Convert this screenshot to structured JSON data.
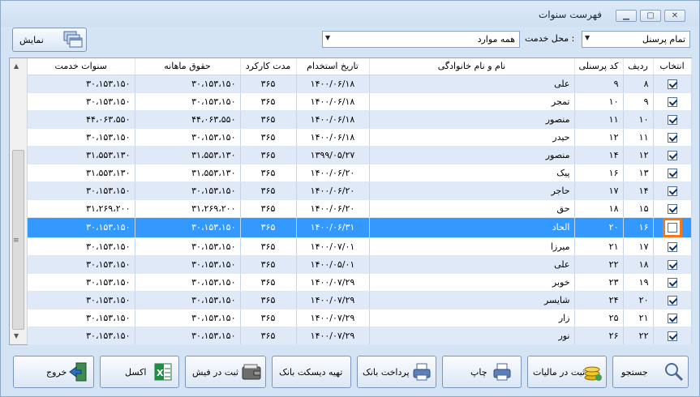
{
  "window": {
    "title": "فهرست سنوات"
  },
  "toolbar": {
    "show_label": "نمایش",
    "service_label": "محل خدمت :",
    "service_value": "همه موارد",
    "personnel_value": "تمام پرسنل"
  },
  "columns": [
    "انتخاب",
    "ردیف",
    "کد پرسنلی",
    "نام و نام خانوادگی",
    "تاریخ استخدام",
    "مدت کارکرد",
    "حقوق ماهانه",
    "سنوات خدمت"
  ],
  "rows": [
    {
      "checked": true,
      "radif": "۸",
      "code": "۹",
      "name": "علی",
      "date": "۱۴۰۰/۰۶/۱۸",
      "days": "۳۶۵",
      "salary": "۳۰،۱۵۳،۱۵۰",
      "sanavat": "۳۰،۱۵۳،۱۵۰"
    },
    {
      "checked": true,
      "radif": "۹",
      "code": "۱۰",
      "name": "تمجر",
      "date": "۱۴۰۰/۰۶/۱۸",
      "days": "۳۶۵",
      "salary": "۳۰،۱۵۳،۱۵۰",
      "sanavat": "۳۰،۱۵۳،۱۵۰"
    },
    {
      "checked": true,
      "radif": "۱۰",
      "code": "۱۱",
      "name": "منصور",
      "date": "۱۴۰۰/۰۶/۱۸",
      "days": "۳۶۵",
      "salary": "۴۴،۰۶۳،۵۵۰",
      "sanavat": "۴۴،۰۶۳،۵۵۰"
    },
    {
      "checked": true,
      "radif": "۱۱",
      "code": "۱۲",
      "name": "حیدر",
      "date": "۱۴۰۰/۰۶/۱۸",
      "days": "۳۶۵",
      "salary": "۳۰،۱۵۳،۱۵۰",
      "sanavat": "۳۰،۱۵۳،۱۵۰"
    },
    {
      "checked": true,
      "radif": "۱۲",
      "code": "۱۴",
      "name": "منصور",
      "date": "۱۳۹۹/۰۵/۲۷",
      "days": "۳۶۵",
      "salary": "۳۱،۵۵۳،۱۳۰",
      "sanavat": "۳۱،۵۵۳،۱۳۰"
    },
    {
      "checked": true,
      "radif": "۱۳",
      "code": "۱۶",
      "name": "پیک",
      "date": "۱۴۰۰/۰۶/۲۰",
      "days": "۳۶۵",
      "salary": "۳۱،۵۵۳،۱۳۰",
      "sanavat": "۳۱،۵۵۳،۱۳۰"
    },
    {
      "checked": true,
      "radif": "۱۴",
      "code": "۱۷",
      "name": "حاجر",
      "date": "۱۴۰۰/۰۶/۲۰",
      "days": "۳۶۵",
      "salary": "۳۰،۱۵۳،۱۵۰",
      "sanavat": "۳۰،۱۵۳،۱۵۰"
    },
    {
      "checked": true,
      "radif": "۱۵",
      "code": "۱۸",
      "name": "حق",
      "date": "۱۴۰۰/۰۶/۲۰",
      "days": "۳۶۵",
      "salary": "۳۱،۲۶۹،۲۰۰",
      "sanavat": "۳۱،۲۶۹،۲۰۰"
    },
    {
      "checked": false,
      "radif": "۱۶",
      "code": "۲۰",
      "name": "الحاد",
      "date": "۱۴۰۰/۰۶/۳۱",
      "days": "۳۶۵",
      "salary": "۳۰،۱۵۳،۱۵۰",
      "sanavat": "۳۰،۱۵۳،۱۵۰",
      "selected": true
    },
    {
      "checked": true,
      "radif": "۱۷",
      "code": "۲۱",
      "name": "میرزا",
      "date": "۱۴۰۰/۰۷/۰۱",
      "days": "۳۶۵",
      "salary": "۳۰،۱۵۳،۱۵۰",
      "sanavat": "۳۰،۱۵۳،۱۵۰"
    },
    {
      "checked": true,
      "radif": "۱۸",
      "code": "۲۲",
      "name": "علی",
      "date": "۱۴۰۰/۰۵/۰۱",
      "days": "۳۶۵",
      "salary": "۳۰،۱۵۳،۱۵۰",
      "sanavat": "۳۰،۱۵۳،۱۵۰"
    },
    {
      "checked": true,
      "radif": "۱۹",
      "code": "۲۳",
      "name": "خوبر",
      "date": "۱۴۰۰/۰۷/۲۹",
      "days": "۳۶۵",
      "salary": "۳۰،۱۵۳،۱۵۰",
      "sanavat": "۳۰،۱۵۳،۱۵۰"
    },
    {
      "checked": true,
      "radif": "۲۰",
      "code": "۲۴",
      "name": "شایسر",
      "date": "۱۴۰۰/۰۷/۲۹",
      "days": "۳۶۵",
      "salary": "۳۰،۱۵۳،۱۵۰",
      "sanavat": "۳۰،۱۵۳،۱۵۰"
    },
    {
      "checked": true,
      "radif": "۲۱",
      "code": "۲۵",
      "name": "زار",
      "date": "۱۴۰۰/۰۷/۲۹",
      "days": "۳۶۵",
      "salary": "۳۰،۱۵۳،۱۵۰",
      "sanavat": "۳۰،۱۵۳،۱۵۰"
    },
    {
      "checked": true,
      "radif": "۲۲",
      "code": "۲۶",
      "name": "نور",
      "date": "۱۴۰۰/۰۷/۲۹",
      "days": "۳۶۵",
      "salary": "۳۰،۱۵۳،۱۵۰",
      "sanavat": "۳۰،۱۵۳،۱۵۰"
    }
  ],
  "buttons": {
    "search": "جستجو",
    "tax": "ثبت در مالیات",
    "print": "چاپ",
    "bank_pay": "پرداخت بانک",
    "bank_disk": "تهیه دیسکت بانک",
    "payslip": "ثبت در فیش",
    "excel": "اکسل",
    "exit": "خروج"
  },
  "colors": {
    "selected_row": "#3399ff",
    "alt_row": "#dfe9f7",
    "highlight": "#f07820"
  }
}
